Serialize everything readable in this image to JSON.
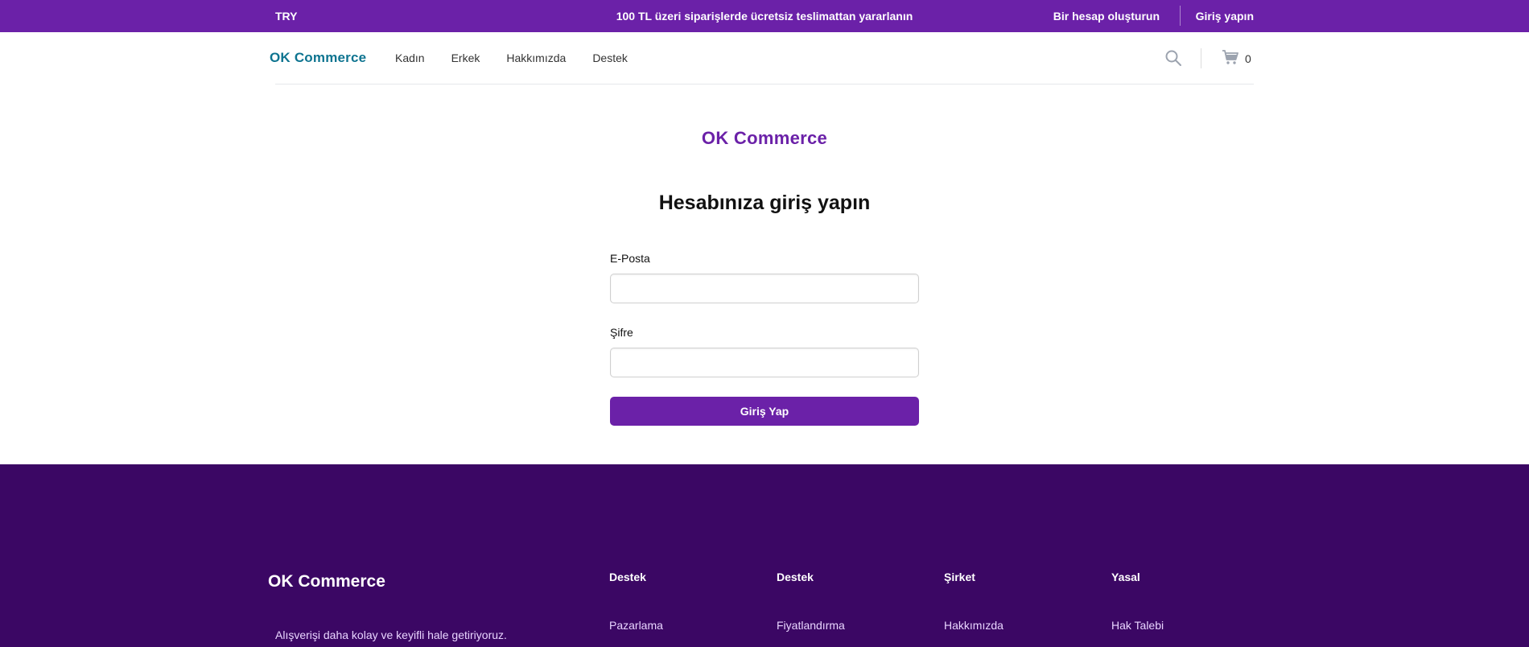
{
  "topbar": {
    "currency": "TRY",
    "promo": "100 TL üzeri siparişlerde ücretsiz teslimattan yararlanın",
    "create_account": "Bir hesap oluşturun",
    "login": "Giriş yapın"
  },
  "header": {
    "logo": "OK Commerce",
    "nav": [
      "Kadın",
      "Erkek",
      "Hakkımızda",
      "Destek"
    ],
    "cart_count": "0",
    "icons": {
      "search": "search-icon",
      "cart": "cart-icon"
    }
  },
  "main": {
    "brand": "OK Commerce",
    "title": "Hesabınıza giriş yapın",
    "email_label": "E-Posta",
    "email_value": "",
    "password_label": "Şifre",
    "password_value": "",
    "submit_label": "Giriş Yap"
  },
  "footer": {
    "logo": "OK Commerce",
    "tagline": "Alışverişi daha kolay ve keyifli hale getiriyoruz.",
    "columns": [
      {
        "title": "Destek",
        "items": [
          "Pazarlama"
        ]
      },
      {
        "title": "Destek",
        "items": [
          "Fiyatlandırma"
        ]
      },
      {
        "title": "Şirket",
        "items": [
          "Hakkımızda"
        ]
      },
      {
        "title": "Yasal",
        "items": [
          "Hak Talebi"
        ]
      }
    ]
  },
  "colors": {
    "primary": "#6b21a8",
    "footer_bg": "#3b0764",
    "logo_teal": "#0e7490"
  }
}
